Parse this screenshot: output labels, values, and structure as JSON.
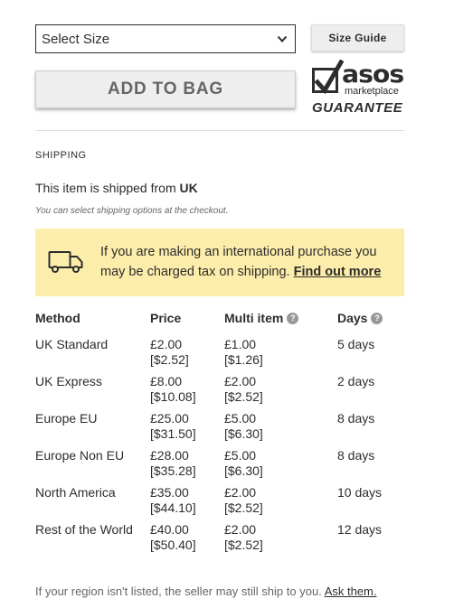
{
  "size_select": {
    "value": "Select Size"
  },
  "size_guide": {
    "label": "Size Guide"
  },
  "add_to_bag": {
    "label": "ADD TO BAG"
  },
  "guarantee": {
    "brand": "asos",
    "sub": "marketplace",
    "label": "GUARANTEE"
  },
  "shipping": {
    "heading": "SHIPPING",
    "shipped_prefix": "This item is shipped from ",
    "shipped_country": "UK",
    "checkout_note": "You can select shipping options at the checkout.",
    "banner_text": "If you are making an international purchase you may be charged tax on shipping. ",
    "banner_link": "Find out more"
  },
  "table": {
    "headers": {
      "method": "Method",
      "price": "Price",
      "multi": "Multi item",
      "days": "Days"
    },
    "help_glyph": "?",
    "rows": [
      {
        "method": "UK Standard",
        "price": "£2.00",
        "price_alt": "[$2.52]",
        "multi": "£1.00",
        "multi_alt": "[$1.26]",
        "days": "5 days"
      },
      {
        "method": "UK Express",
        "price": "£8.00",
        "price_alt": "[$10.08]",
        "multi": "£2.00",
        "multi_alt": "[$2.52]",
        "days": "2 days"
      },
      {
        "method": "Europe EU",
        "price": "£25.00",
        "price_alt": "[$31.50]",
        "multi": "£5.00",
        "multi_alt": "[$6.30]",
        "days": "8 days"
      },
      {
        "method": "Europe Non EU",
        "price": "£28.00",
        "price_alt": "[$35.28]",
        "multi": "£5.00",
        "multi_alt": "[$6.30]",
        "days": "8 days"
      },
      {
        "method": "North America",
        "price": "£35.00",
        "price_alt": "[$44.10]",
        "multi": "£2.00",
        "multi_alt": "[$2.52]",
        "days": "10 days"
      },
      {
        "method": "Rest of the World",
        "price": "£40.00",
        "price_alt": "[$50.40]",
        "multi": "£2.00",
        "multi_alt": "[$2.52]",
        "days": "12 days"
      }
    ]
  },
  "footer": {
    "text": "If your region isn't listed, the seller may still ship to you. ",
    "link": "Ask them."
  },
  "colors": {
    "banner_bg": "#fcedaa",
    "text": "#2d2d2d",
    "muted": "#666666",
    "button_bg": "#eeeeee"
  },
  "icons": [
    "chevron-down-icon",
    "checkmark-icon",
    "delivery-truck-icon",
    "help-icon"
  ]
}
